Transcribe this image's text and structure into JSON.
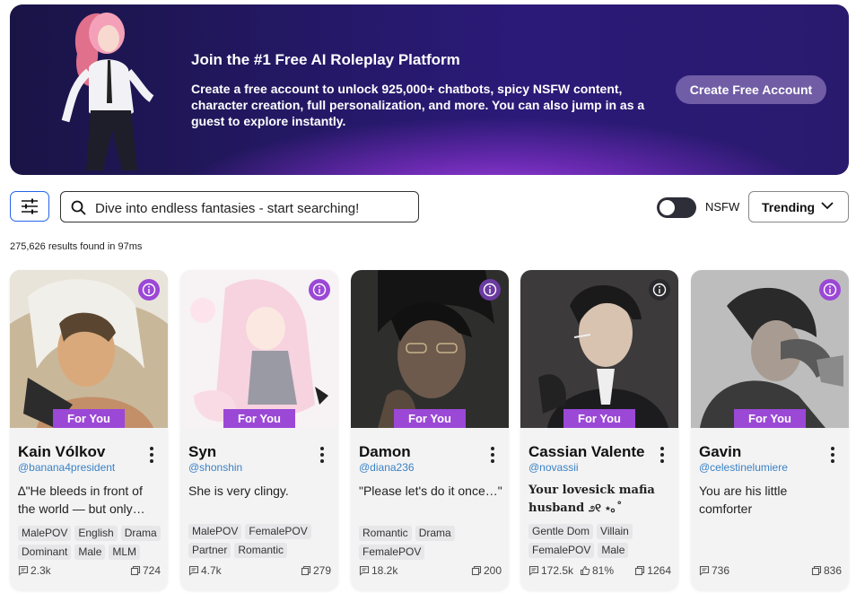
{
  "banner": {
    "title": "Join the #1 Free AI Roleplay Platform",
    "text": "Create a free account to unlock 925,000+ chatbots, spicy NSFW content, character creation, full personalization, and more. You can also jump in as a guest to explore instantly.",
    "cta": "Create Free Account"
  },
  "search": {
    "placeholder": "Dive into endless fantasies - start searching!"
  },
  "nsfw_label": "NSFW",
  "sort": {
    "selected": "Trending"
  },
  "results_text": "275,626 results found in 97ms",
  "cards": [
    {
      "badge": "For You",
      "name": "Kain Vólkov",
      "user": "@banana4president",
      "desc": "∆\"He bleeds in front of the world — but only…",
      "tags": [
        "MalePOV",
        "English",
        "Drama",
        "Dominant",
        "Male",
        "MLM"
      ],
      "chats": "2.3k",
      "likes": "",
      "saves": "724"
    },
    {
      "badge": "For You",
      "name": "Syn",
      "user": "@shonshin",
      "desc": "She is very clingy.",
      "tags": [
        "MalePOV",
        "FemalePOV",
        "Partner",
        "Romantic"
      ],
      "chats": "4.7k",
      "likes": "",
      "saves": "279"
    },
    {
      "badge": "For You",
      "name": "Damon",
      "user": "@diana236",
      "desc": "\"Please let's do it once…\"",
      "tags": [
        "Romantic",
        "Drama",
        "FemalePOV"
      ],
      "chats": "18.2k",
      "likes": "",
      "saves": "200"
    },
    {
      "badge": "For You",
      "name": "Cassian Valente",
      "user": "@novassii",
      "desc": "Your lovesick mafia husband ೨୧ ⋆｡˚",
      "tags": [
        "Gentle Dom",
        "Villain",
        "FemalePOV",
        "Male"
      ],
      "chats": "172.5k",
      "likes": "81%",
      "saves": "1264"
    },
    {
      "badge": "For You",
      "name": "Gavin",
      "user": "@celestinelumiere",
      "desc": "You are his little comforter",
      "tags": [],
      "chats": "736",
      "likes": "",
      "saves": "836"
    }
  ],
  "colors": {
    "accent": "#9b48d6",
    "link": "#3b82c4",
    "focus": "#2563eb"
  }
}
